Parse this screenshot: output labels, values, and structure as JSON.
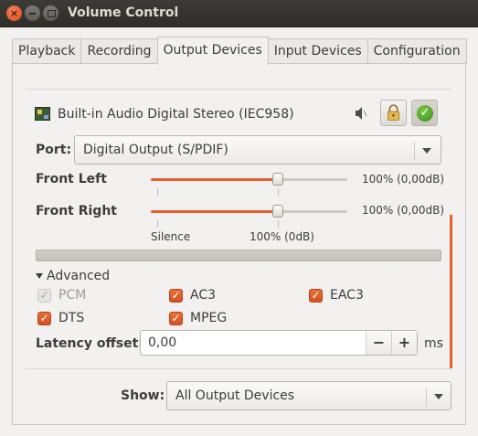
{
  "window": {
    "title": "Volume Control",
    "close_glyph": "×",
    "min_glyph": "",
    "max_glyph": ""
  },
  "tabs": [
    {
      "label": "Playback"
    },
    {
      "label": "Recording"
    },
    {
      "label": "Output Devices",
      "active": true
    },
    {
      "label": "Input Devices"
    },
    {
      "label": "Configuration"
    }
  ],
  "device": {
    "name": "Built-in Audio Digital Stereo (IEC958)",
    "icon": "sound-card-icon",
    "mute_icon": "speaker-muted-icon",
    "lock_icon": "lock-icon",
    "default_icon": "check-icon",
    "default_glyph": "✓"
  },
  "port": {
    "label": "Port:",
    "value": "Digital Output (S/PDIF)"
  },
  "channels": [
    {
      "label": "Front Left",
      "value_text": "100% (0,00dB)",
      "level_percent": 100
    },
    {
      "label": "Front Right",
      "value_text": "100% (0,00dB)",
      "level_percent": 100
    }
  ],
  "scale": {
    "silence": "Silence",
    "normal": "100% (0dB)"
  },
  "advanced": {
    "label": "Advanced",
    "codecs": [
      {
        "label": "PCM",
        "checked": true,
        "enabled": false
      },
      {
        "label": "AC3",
        "checked": true,
        "enabled": true
      },
      {
        "label": "EAC3",
        "checked": true,
        "enabled": true
      },
      {
        "label": "DTS",
        "checked": true,
        "enabled": true
      },
      {
        "label": "MPEG",
        "checked": true,
        "enabled": true
      }
    ],
    "check_glyph": "✓"
  },
  "latency": {
    "label": "Latency offset:",
    "value": "0,00",
    "unit": "ms",
    "minus": "−",
    "plus": "+"
  },
  "show": {
    "label": "Show:",
    "value": "All Output Devices"
  },
  "colors": {
    "accent": "#e0632f",
    "titlebar": "#3c3b37",
    "window_bg": "#f2f1f0"
  }
}
